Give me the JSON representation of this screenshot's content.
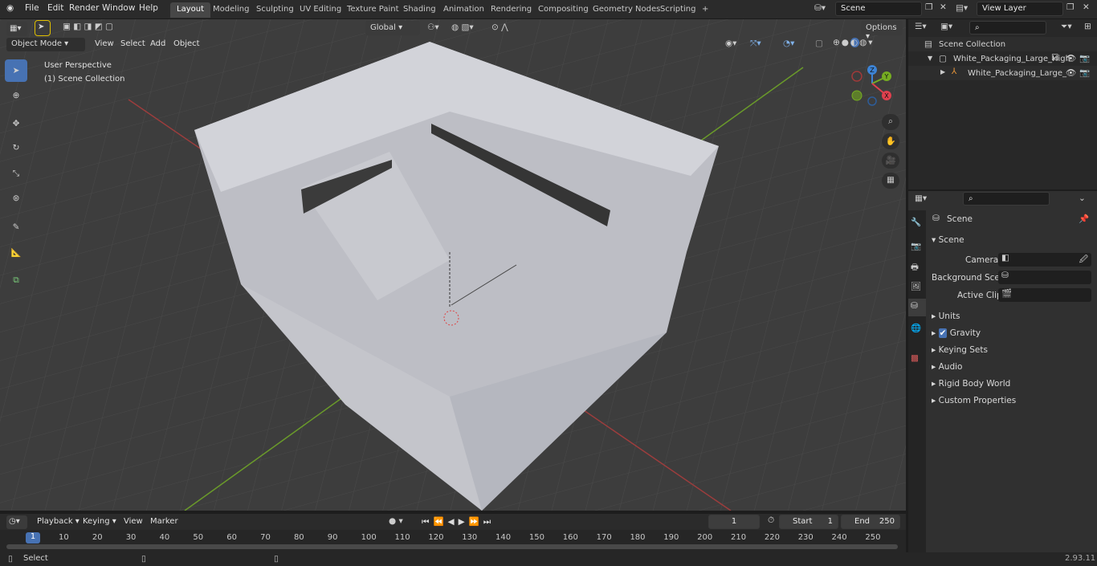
{
  "topbar": {
    "menus": [
      "File",
      "Edit",
      "Render",
      "Window",
      "Help"
    ],
    "workspaces": [
      "Layout",
      "Modeling",
      "Sculpting",
      "UV Editing",
      "Texture Paint",
      "Shading",
      "Animation",
      "Rendering",
      "Compositing",
      "Geometry Nodes",
      "Scripting"
    ],
    "add_tab": "+",
    "scene_field": "Scene",
    "view_layer_field": "View Layer"
  },
  "viewport_header": {
    "mode": "Object Mode",
    "menus": [
      "View",
      "Select",
      "Add",
      "Object"
    ],
    "transform_orientation": "Global",
    "options": "Options"
  },
  "viewport": {
    "perspective_label": "User Perspective",
    "collection_label": "(1) Scene Collection",
    "gizmo": {
      "z": "Z",
      "y": "Y",
      "x": "X"
    }
  },
  "outliner": {
    "root": "Scene Collection",
    "items": [
      "White_Packaging_Large_High",
      "White_Packaging_Large_"
    ]
  },
  "properties": {
    "context": "Scene",
    "panel": "Scene",
    "fields": [
      {
        "label": "Camera"
      },
      {
        "label": "Background Scene"
      },
      {
        "label": "Active Clip"
      }
    ],
    "subpanels": [
      "Units",
      "Gravity",
      "Keying Sets",
      "Audio",
      "Rigid Body World",
      "Custom Properties"
    ],
    "gravity_checked": true
  },
  "timeline": {
    "menus": [
      "Playback",
      "Keying",
      "View",
      "Marker"
    ],
    "current_frame": "1",
    "start_label": "Start",
    "start": "1",
    "end_label": "End",
    "end": "250",
    "ticks": [
      "10",
      "20",
      "30",
      "40",
      "50",
      "60",
      "70",
      "80",
      "90",
      "100",
      "110",
      "120",
      "130",
      "140",
      "150",
      "160",
      "170",
      "180",
      "190",
      "200",
      "210",
      "220",
      "230",
      "240",
      "250"
    ],
    "frame_marker": "1"
  },
  "status": {
    "left": "Select",
    "version": "2.93.11"
  },
  "colors": {
    "accent": "#4772b3",
    "x_axis": "#9c3d3d",
    "y_axis": "#6a9a2a",
    "gizmo_x": "#e0404e",
    "gizmo_y": "#76ad22",
    "gizmo_z": "#3d84d6"
  }
}
